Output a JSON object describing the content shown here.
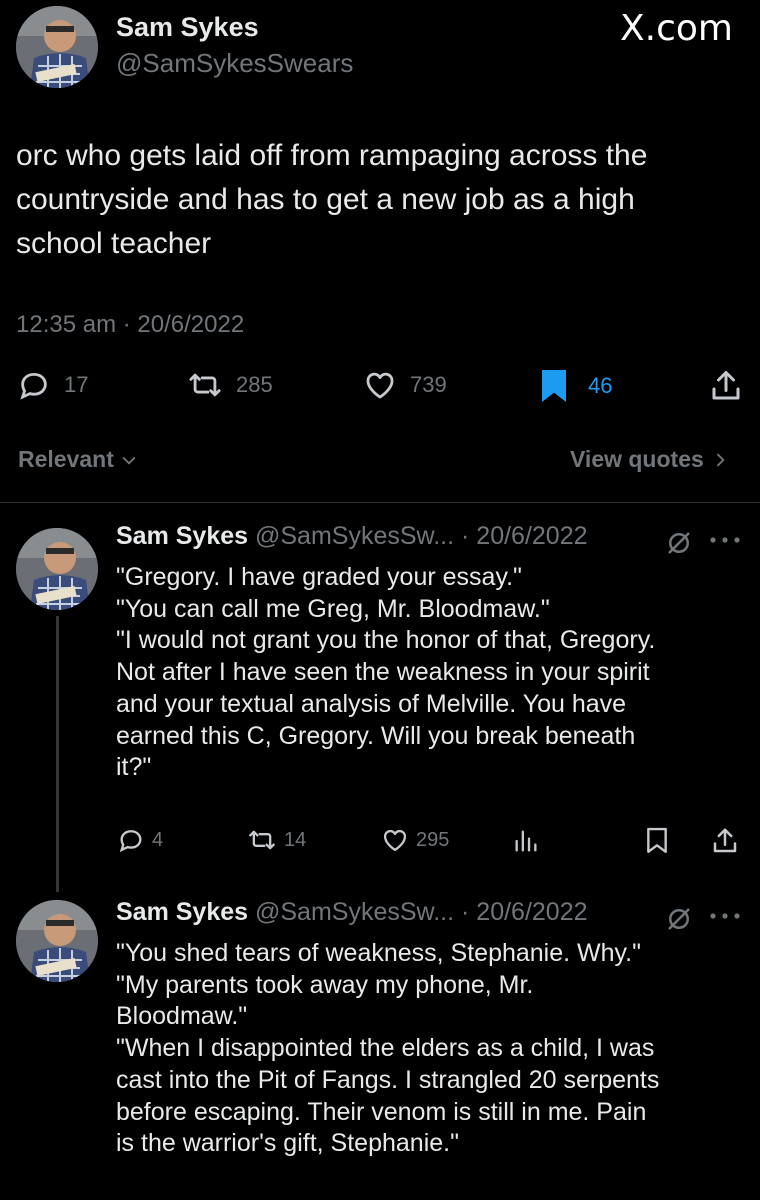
{
  "brand": {
    "logo_text": "X.com"
  },
  "main_tweet": {
    "author_name": "Sam Sykes",
    "author_handle": "@SamSykesSwears",
    "text_lines": [
      "orc who gets laid off from rampaging across the",
      "countryside and has to get a new job as a high",
      "school teacher"
    ],
    "timestamp": "12:35 am · 20/6/2022",
    "actions": {
      "replies": "17",
      "retweets": "285",
      "likes": "739",
      "bookmarks": "46"
    },
    "icons": [
      "reply-icon",
      "retweet-icon",
      "like-icon",
      "bookmark-icon",
      "share-icon"
    ],
    "accent_color": "#1d9bf0"
  },
  "reply_controls": {
    "sort_label": "Relevant",
    "view_quotes_label": "View quotes"
  },
  "replies": [
    {
      "author_name": "Sam Sykes",
      "author_handle": "@SamSykesSw...",
      "date": "· 20/6/2022",
      "text_lines": [
        "\"Gregory. I have graded your essay.\"",
        "\"You can call me Greg, Mr. Bloodmaw.\"",
        "\"I would not grant you the honor of that, Gregory.",
        "Not after I have seen the weakness in your spirit",
        "and your textual analysis of Melville. You have",
        "earned this C, Gregory. Will you break beneath",
        "it?\""
      ],
      "actions": {
        "replies": "4",
        "retweets": "14",
        "likes": "295"
      }
    },
    {
      "author_name": "Sam Sykes",
      "author_handle": "@SamSykesSw...",
      "date": "· 20/6/2022",
      "text_lines": [
        "\"You shed tears of weakness, Stephanie. Why.\"",
        "\"My parents took away my phone, Mr.",
        "Bloodmaw.\"",
        "\"When I disappointed the elders as a child, I was",
        "cast into the Pit of Fangs. I strangled 20 serpents",
        "before escaping. Their venom is still in me. Pain",
        "is the warrior's gift, Stephanie.\""
      ]
    }
  ]
}
